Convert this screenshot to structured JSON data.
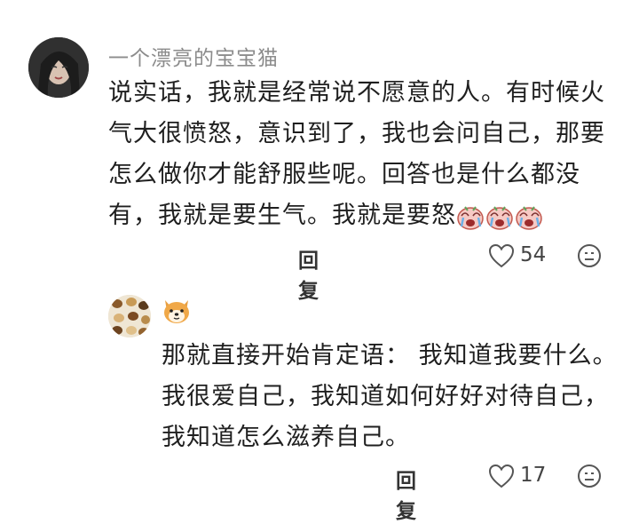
{
  "comment_main": {
    "username": "一个漂亮的宝宝猫",
    "lines": [
      "说实话，我就是经常说不愿意的人。有时候火",
      "气大很愤怒，意识到了，我也会问自己，那要",
      "怎么做你才能舒服些呢。回答也是什么都没",
      "有，我就是要生气。我就是要怒"
    ],
    "emoji_count": 3,
    "emoji_icon": "crying-face-sticker",
    "reply_label": "回复",
    "like_count": "54",
    "like_icon": "heart-outline",
    "dislike_icon": "neutral-face"
  },
  "comment_reply": {
    "username_emoji_icon": "shiba-dog-face",
    "lines": [
      "那就直接开始肯定语： 我知道我要什么。",
      "我很爱自己，我知道如何好好对待自己，",
      "我知道怎么滋养自己。"
    ],
    "reply_label": "回复",
    "like_count": "17",
    "like_icon": "heart-outline",
    "dislike_icon": "neutral-face"
  }
}
